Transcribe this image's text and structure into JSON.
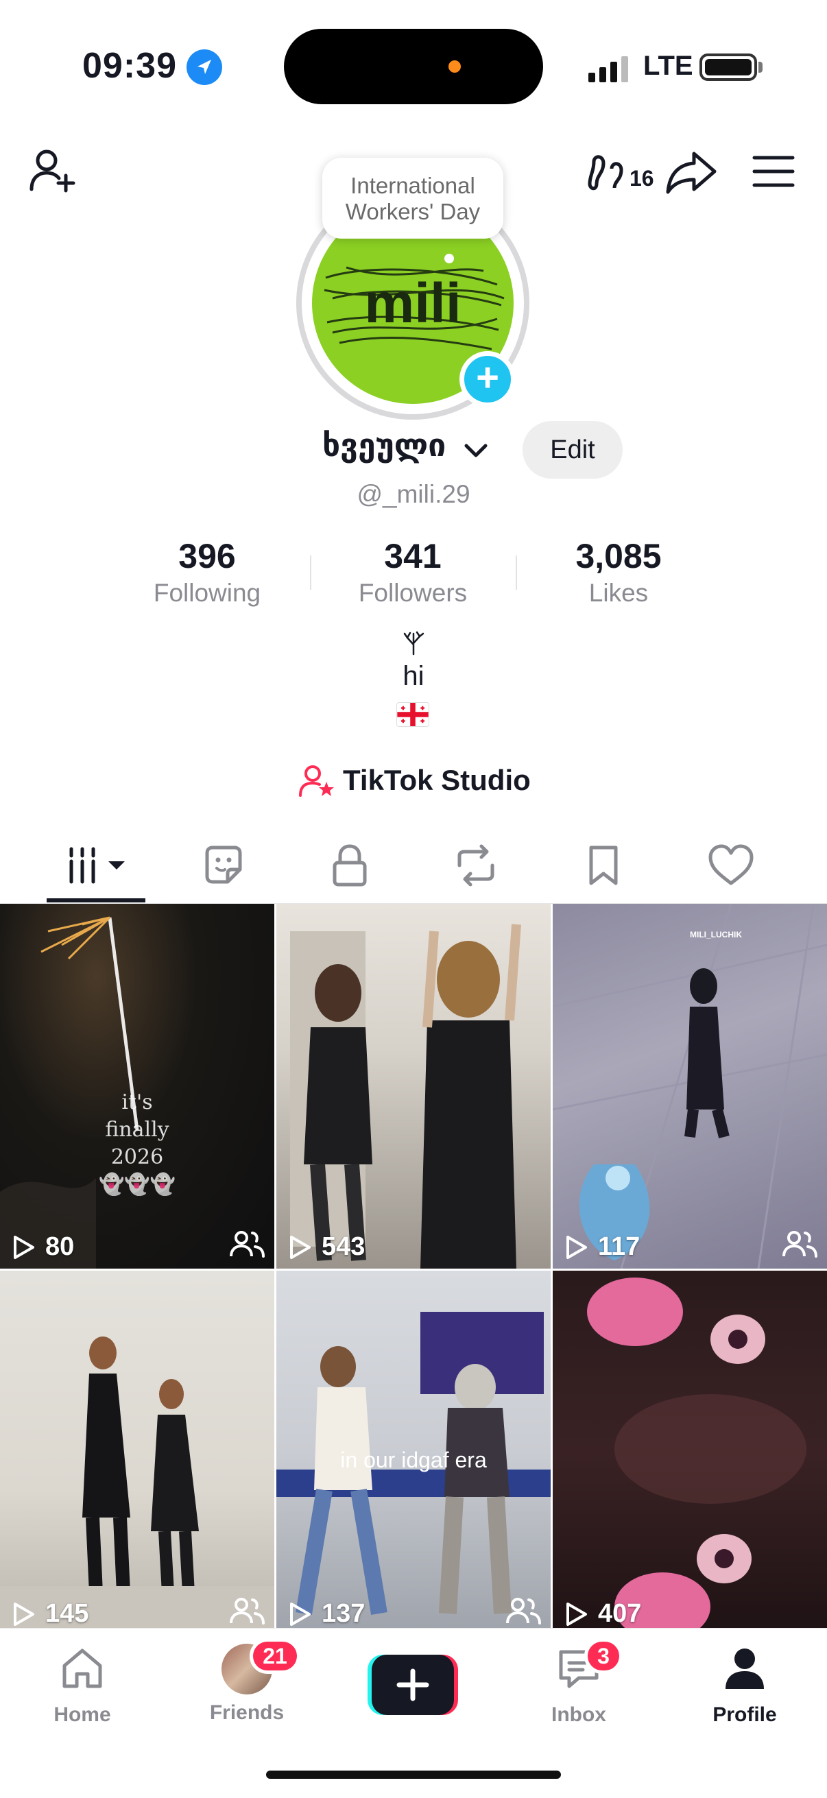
{
  "status_bar": {
    "time": "09:39",
    "network": "LTE"
  },
  "note": {
    "text_line1": "International",
    "text_line2": "Workers' Day"
  },
  "profile": {
    "display_name": "ხვეული",
    "username": "@_mili.29",
    "edit_label": "Edit",
    "bio": "hi",
    "creator_badge_count": "16",
    "avatar_text": "mili"
  },
  "stats": [
    {
      "value": "396",
      "label": "Following"
    },
    {
      "value": "341",
      "label": "Followers"
    },
    {
      "value": "3,085",
      "label": "Likes"
    }
  ],
  "studio": {
    "label": "TikTok Studio"
  },
  "tabs": [
    "videos-icon",
    "sticker-icon",
    "lock-icon",
    "repost-icon",
    "bookmark-icon",
    "heart-icon"
  ],
  "videos": [
    {
      "views": "80",
      "friends_only": true,
      "overlay": [
        "it's",
        "finally",
        "2026",
        "👻👻👻"
      ]
    },
    {
      "views": "543",
      "friends_only": false,
      "overlay": []
    },
    {
      "views": "117",
      "friends_only": true,
      "overlay": [
        "MILI_LUCHIK"
      ]
    },
    {
      "views": "145",
      "friends_only": true,
      "overlay": []
    },
    {
      "views": "137",
      "friends_only": true,
      "overlay": [
        "in our idgaf era"
      ]
    },
    {
      "views": "407",
      "friends_only": false,
      "overlay": []
    }
  ],
  "nav": {
    "home": "Home",
    "friends": "Friends",
    "friends_badge": "21",
    "inbox": "Inbox",
    "inbox_badge": "3",
    "profile": "Profile"
  },
  "colors": {
    "accent": "#fe2c55",
    "cyan": "#20c4f0",
    "avatar_bg": "#8bd023"
  }
}
